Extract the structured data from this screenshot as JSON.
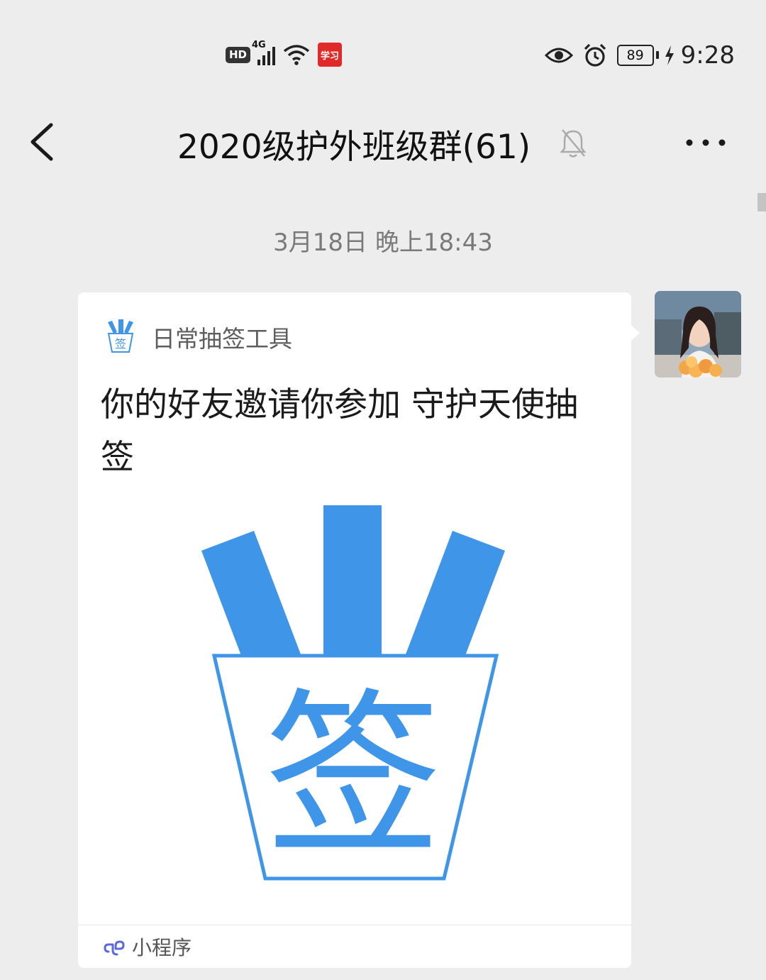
{
  "status_bar": {
    "hd_badge": "HD",
    "network": "4G",
    "app_badge": "学习",
    "battery": "89",
    "time": "9:28"
  },
  "header": {
    "title": "2020级护外班级群(61)",
    "icons": [
      "back-chevron-icon",
      "mute-bell-icon",
      "more-dots-icon"
    ]
  },
  "chat": {
    "timestamp": "3月18日 晚上18:43",
    "message_card": {
      "app_name": "日常抽签工具",
      "text": "你的好友邀请你参加 守护天使抽签",
      "image_char": "签",
      "footer_label": "小程序"
    }
  },
  "colors": {
    "accent_blue": "#3f96e8",
    "background": "#ededed",
    "card": "#ffffff"
  }
}
